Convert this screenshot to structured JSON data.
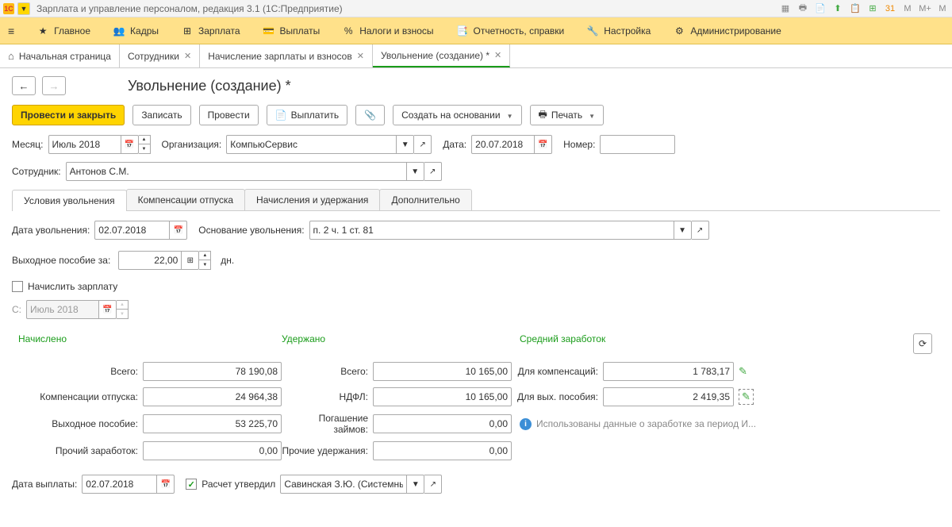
{
  "titlebar": {
    "title": "Зарплата и управление персоналом, редакция 3.1  (1С:Предприятие)"
  },
  "menu": {
    "main": "Главное",
    "staff": "Кадры",
    "salary": "Зарплата",
    "payments": "Выплаты",
    "taxes": "Налоги и взносы",
    "reports": "Отчетность, справки",
    "settings": "Настройка",
    "admin": "Администрирование"
  },
  "tabs": {
    "home": "Начальная страница",
    "t1": "Сотрудники",
    "t2": "Начисление зарплаты и взносов",
    "t3": "Увольнение (создание) *"
  },
  "page_title": "Увольнение (создание) *",
  "toolbar": {
    "post_close": "Провести и закрыть",
    "save": "Записать",
    "post": "Провести",
    "pay": "Выплатить",
    "create_based": "Создать на основании",
    "print": "Печать"
  },
  "form": {
    "month_label": "Месяц:",
    "month_value": "Июль 2018",
    "org_label": "Организация:",
    "org_value": "КомпьюСервис",
    "date_label": "Дата:",
    "date_value": "20.07.2018",
    "number_label": "Номер:",
    "number_value": "",
    "employee_label": "Сотрудник:",
    "employee_value": "Антонов С.М."
  },
  "subtabs": {
    "t1": "Условия увольнения",
    "t2": "Компенсации отпуска",
    "t3": "Начисления и удержания",
    "t4": "Дополнительно"
  },
  "dismissal": {
    "date_label": "Дата увольнения:",
    "date_value": "02.07.2018",
    "basis_label": "Основание увольнения:",
    "basis_value": "п. 2 ч. 1 ст. 81",
    "severance_label": "Выходное пособие за:",
    "severance_value": "22,00",
    "days_suffix": "дн.",
    "accrue_salary_label": "Начислить зарплату",
    "from_label": "С:",
    "from_value": "Июль 2018"
  },
  "sections": {
    "accrued": "Начислено",
    "withheld": "Удержано",
    "avg_salary": "Средний заработок"
  },
  "amounts": {
    "total_label": "Всего:",
    "total_accrued": "78 190,08",
    "total_withheld": "10 165,00",
    "comp_vac_label": "Компенсации отпуска:",
    "comp_vac": "24 964,38",
    "ndfl_label": "НДФЛ:",
    "ndfl": "10 165,00",
    "severance_label": "Выходное пособие:",
    "severance": "53 225,70",
    "loans_label": "Погашение займов:",
    "loans": "0,00",
    "other_income_label": "Прочий заработок:",
    "other_income": "0,00",
    "other_withheld_label": "Прочие удержания:",
    "other_withheld": "0,00",
    "for_comp_label": "Для компенсаций:",
    "for_comp": "1 783,17",
    "for_sev_label": "Для вых. пособия:",
    "for_sev": "2 419,35",
    "info": "Использованы данные о заработке за период И..."
  },
  "footer": {
    "pay_date_label": "Дата выплаты:",
    "pay_date": "02.07.2018",
    "approved_label": "Расчет утвердил",
    "approver": "Савинская З.Ю. (Системны"
  }
}
